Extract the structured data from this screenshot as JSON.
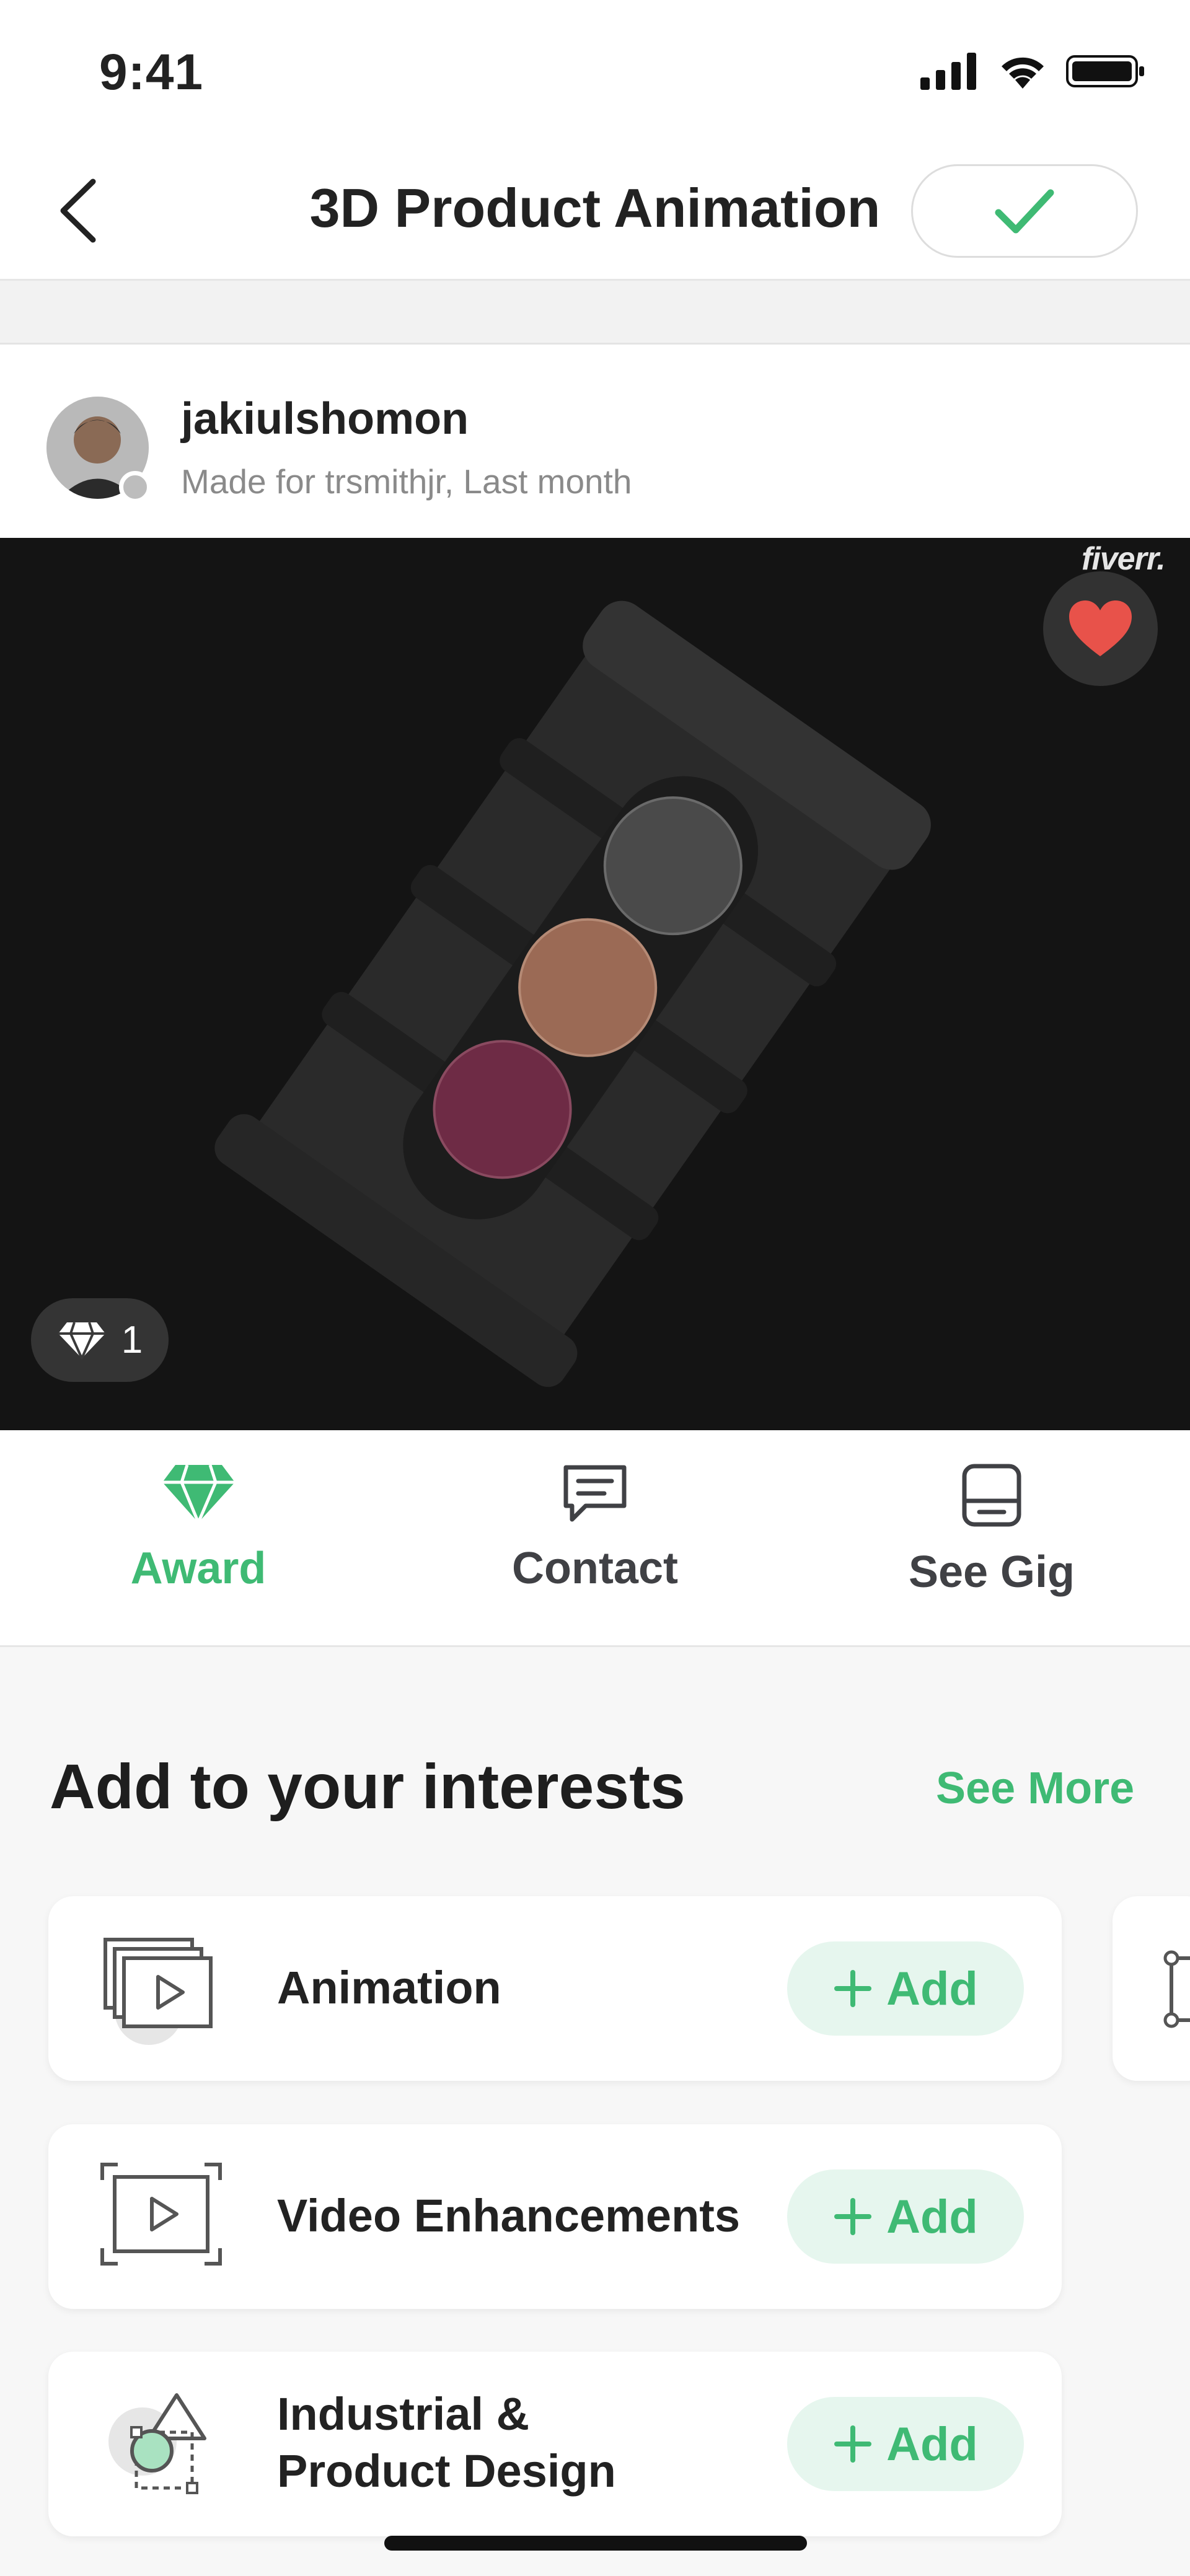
{
  "status_bar": {
    "time": "9:41"
  },
  "nav": {
    "title": "3D Product Animation"
  },
  "author": {
    "name": "jakiulshomon",
    "subtitle": "Made for trsmithjr, Last month"
  },
  "media": {
    "brand": "fiverr.",
    "award_count": "1"
  },
  "actions": [
    {
      "label": "Award",
      "icon": "diamond-icon"
    },
    {
      "label": "Contact",
      "icon": "chat-icon"
    },
    {
      "label": "See Gig",
      "icon": "gig-icon"
    }
  ],
  "interests": {
    "title": "Add to your interests",
    "see_more": "See More",
    "add_label": "Add",
    "items": [
      {
        "label": "Animation",
        "icon": "animation-icon"
      },
      {
        "label": "Video Enhancements",
        "icon": "video-enhancement-icon"
      },
      {
        "label_line1": "Industrial &",
        "label_line2": "Product Design",
        "icon": "product-design-icon"
      }
    ]
  },
  "colors": {
    "accent": "#3fba74",
    "favorite": "#e8524a",
    "media_bg": "#141414"
  }
}
